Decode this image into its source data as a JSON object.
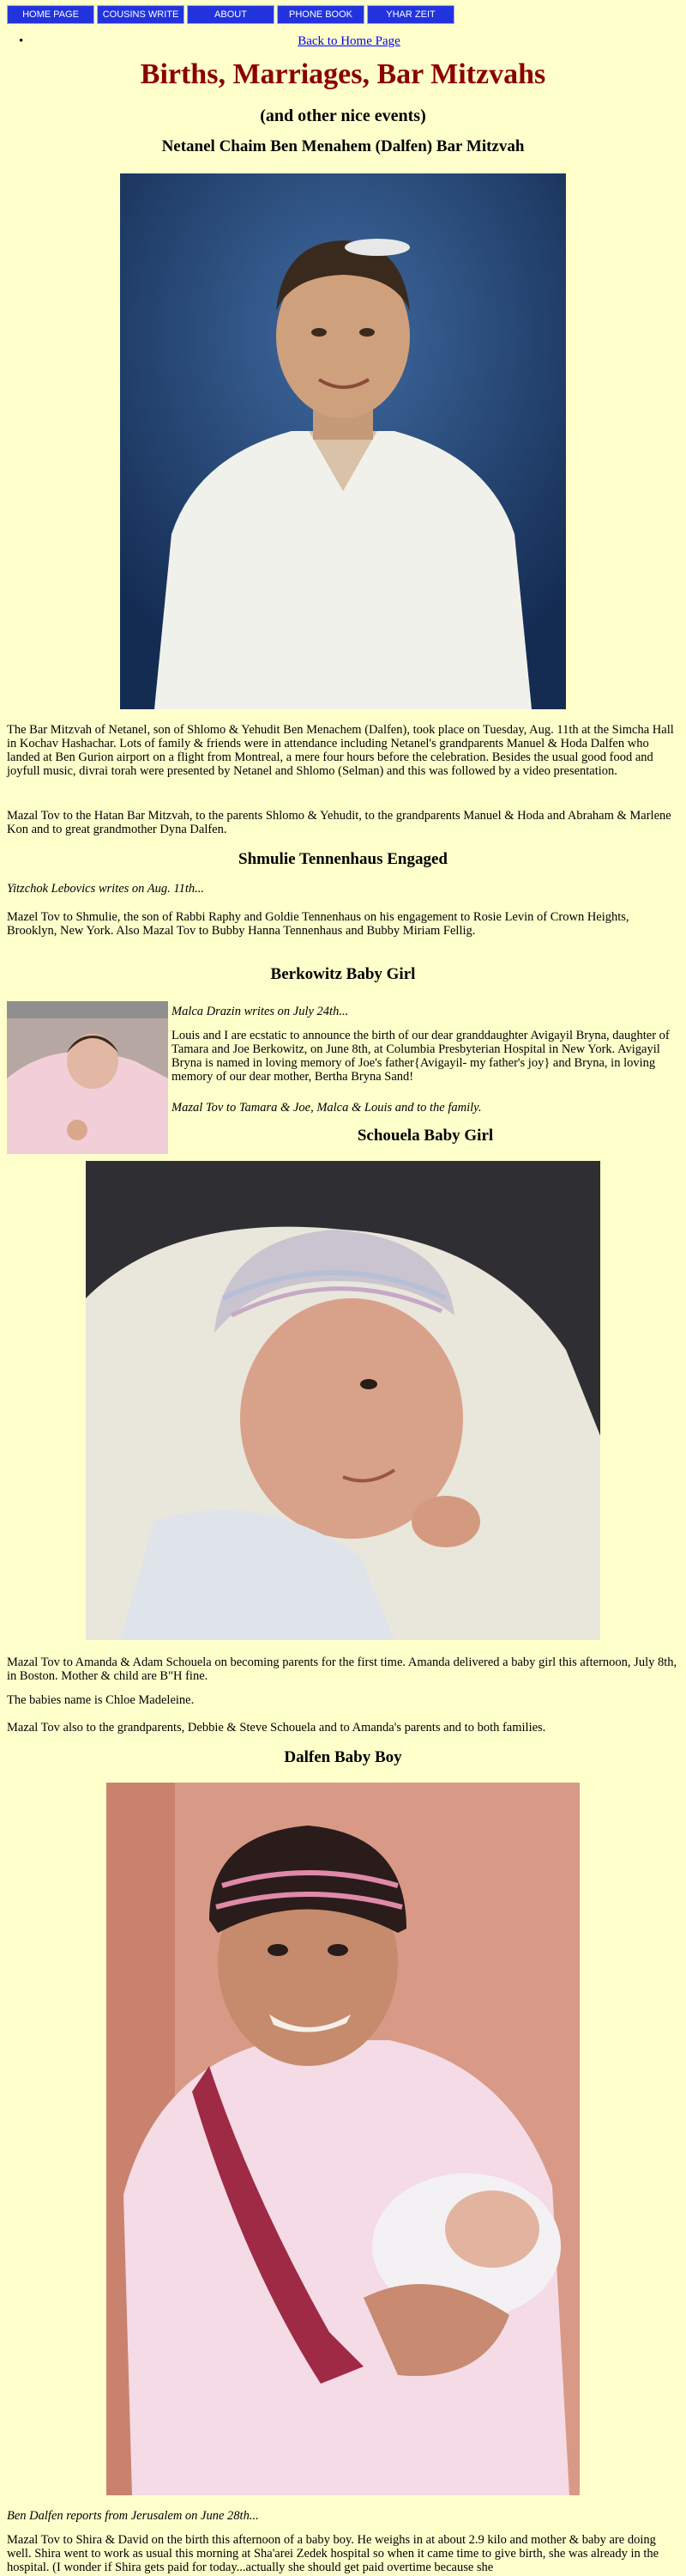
{
  "nav": [
    "HOME PAGE",
    "COUSINS WRITE",
    "ABOUT",
    "PHONE BOOK",
    "YHAR ZEIT"
  ],
  "back_link": "Back to Home Page",
  "page_title": "Births, Marriages, Bar Mitzvahs",
  "page_subtitle": "(and other nice events)",
  "sections": [
    {
      "heading": "Netanel Chaim Ben Menahem (Dalfen) Bar Mitzvah",
      "paragraphs": [
        "The Bar Mitzvah of Netanel, son of Shlomo & Yehudit Ben Menachem (Dalfen), took place on Tuesday, Aug. 11th at the Simcha Hall in Kochav Hashachar. Lots of family & friends were in attendance including Netanel's grandparents Manuel & Hoda Dalfen who landed at Ben Gurion airport on a flight from Montreal, a mere four hours before the celebration. Besides the usual good food and joyfull music, divrai torah were presented by Netanel and Shlomo (Selman) and this was followed by a video presentation.",
        "Mazal Tov to the Hatan Bar Mitzvah, to the parents Shlomo & Yehudit, to the grandparents Manuel & Hoda and Abraham & Marlene Kon and to great grandmother Dyna Dalfen."
      ]
    },
    {
      "heading": "Shmulie Tennenhaus Engaged",
      "byline": "Yitzchok Lebovics writes on Aug. 11th...",
      "paragraphs": [
        "Mazel Tov to Shmulie, the son of Rabbi Raphy and Goldie Tennenhaus on his engagement to Rosie Levin of Crown Heights, Brooklyn, New York. Also Mazal Tov to Bubby Hanna Tennenhaus and Bubby Miriam Fellig."
      ]
    },
    {
      "heading": "Berkowitz Baby Girl",
      "byline": "Malca Drazin writes on July 24th...",
      "paragraphs": [
        "Louis and I are ecstatic to announce the birth of our dear granddaughter Avigayil Bryna, daughter of Tamara and Joe Berkowitz, on June 8th, at Columbia Presbyterian Hospital in New York. Avigayil Bryna is named in loving memory of Joe's father{Avigayil- my father's joy} and Bryna, in loving memory of our dear mother, Bertha Bryna Sand!"
      ],
      "closing": "Mazal Tov to Tamara & Joe, Malca & Louis and to the family."
    },
    {
      "heading": "Schouela Baby Girl",
      "paragraphs": [
        "Mazal Tov to Amanda & Adam Schouela on becoming parents for the first time. Amanda delivered a baby girl this afternoon, July 8th, in Boston. Mother & child are B\"H fine.",
        "The babies name is Chloe Madeleine.",
        "Mazal Tov also to the grandparents, Debbie & Steve Schouela and to Amanda's parents and to both families."
      ]
    },
    {
      "heading": "Dalfen Baby Boy",
      "byline": "Ben Dalfen reports from Jerusalem on June 28th...",
      "paragraphs": [
        "Mazal Tov to Shira & David on the birth this afternoon of a baby boy. He weighs in at about 2.9 kilo and mother & baby are doing well. Shira went to work as usual this morning at Sha'arei Zedek hospital so when it came time to give birth, she was already in the hospital. (I wonder if Shira gets paid for today...actually she should get paid overtime because she"
      ]
    }
  ],
  "colors": {
    "background": "#ffffcc",
    "title": "#8b0000",
    "nav_bg": "#2233dd",
    "link": "#0000ee"
  }
}
